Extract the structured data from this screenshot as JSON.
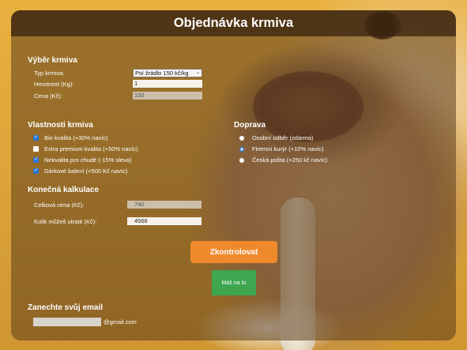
{
  "title": "Objednávka krmiva",
  "feed_selection": {
    "heading": "Výběr krmiva",
    "type_label": "Typ krmiva:",
    "type_value": "Psí žrádlo 150 kč/kg",
    "weight_label": "Hmotnost (Kg):",
    "weight_value": "1",
    "price_label": "Cena (Kč):",
    "price_value": "150"
  },
  "properties": {
    "heading": "Vlastnosti krmiva",
    "items": [
      {
        "label": "Bio kvalita (+30% navíc)",
        "checked": true
      },
      {
        "label": "Extra premium kvalita (+50% navíc)",
        "checked": false
      },
      {
        "label": "Nekvalita pro chudé (-15% sleva)",
        "checked": true
      },
      {
        "label": "Dárkové balení (+500 Kč navíc)",
        "checked": true
      }
    ]
  },
  "delivery": {
    "heading": "Doprava",
    "options": [
      {
        "label": "Osobní odběr (zdarma)",
        "selected": false
      },
      {
        "label": "Firemní kurýr (+10% navíc)",
        "selected": true
      },
      {
        "label": "Česká pošta (+250 kč navíc)",
        "selected": false
      }
    ]
  },
  "calculation": {
    "heading": "Konečná kalkulace",
    "total_label": "Celková cena (Kč):",
    "total_value": "740",
    "spend_label": "Kolik můžeš utratit (Kč):",
    "spend_value": "4566"
  },
  "check_button": "Zkontrolovat",
  "result_text": "Máš na to",
  "email": {
    "heading": "Zanechte svůj email",
    "value": "",
    "suffix": "@gmail.com"
  },
  "colors": {
    "accent_orange": "#ef8a2c",
    "result_green": "#3da64f",
    "checkbox_blue": "#2d77d6"
  }
}
